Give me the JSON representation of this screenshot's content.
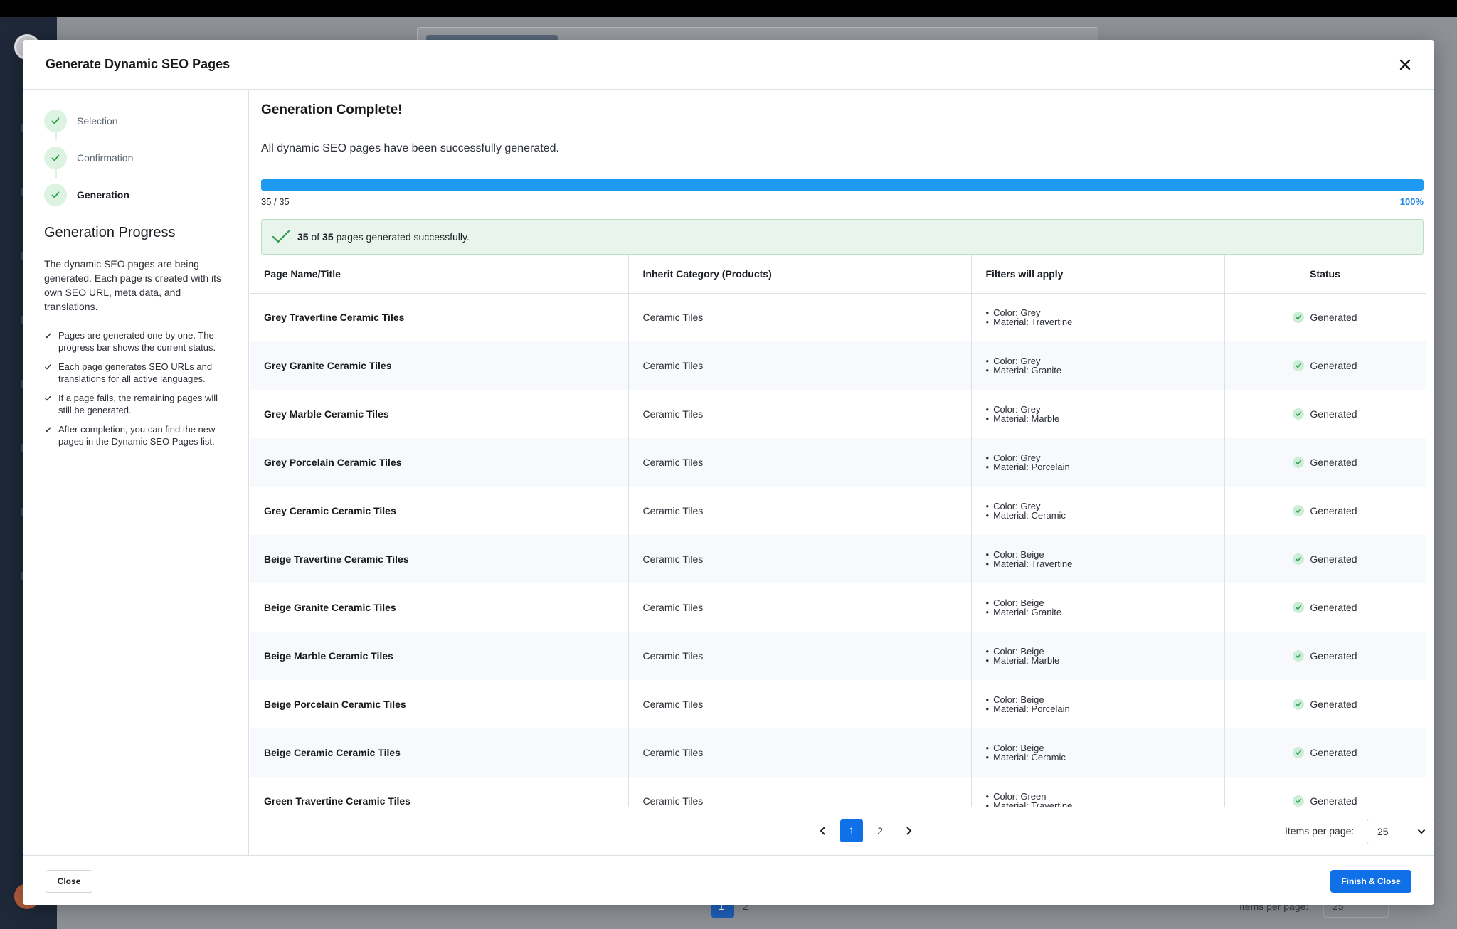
{
  "modal": {
    "title": "Generate Dynamic SEO Pages"
  },
  "steps": [
    {
      "label": "Selection",
      "done": true
    },
    {
      "label": "Confirmation",
      "done": true
    },
    {
      "label": "Generation",
      "done": true,
      "active": true
    }
  ],
  "left": {
    "title": "Generation Progress",
    "description": "The dynamic SEO pages are being generated. Each page is created with its own SEO URL, meta data, and translations.",
    "tips": [
      "Pages are generated one by one. The progress bar shows the current status.",
      "Each page generates SEO URLs and translations for all active languages.",
      "If a page fails, the remaining pages will still be generated.",
      "After completion, you can find the new pages in the Dynamic SEO Pages list."
    ]
  },
  "result": {
    "title": "Generation Complete!",
    "subtitle": "All dynamic SEO pages have been successfully generated.",
    "progress_fraction": 1.0,
    "progress_count": "35 / 35",
    "progress_percent": "100%",
    "banner_done": "35",
    "banner_of": "of",
    "banner_total": "35",
    "banner_suffix": "pages generated successfully."
  },
  "table": {
    "headers": [
      "Page Name/Title",
      "Inherit Category (Products)",
      "Filters will apply",
      "Status"
    ],
    "rows": [
      {
        "title": "Grey Travertine Ceramic Tiles",
        "category": "Ceramic Tiles",
        "filters": [
          "Color: Grey",
          "Material: Travertine"
        ],
        "status": "Generated"
      },
      {
        "title": "Grey Granite Ceramic Tiles",
        "category": "Ceramic Tiles",
        "filters": [
          "Color: Grey",
          "Material: Granite"
        ],
        "status": "Generated"
      },
      {
        "title": "Grey Marble Ceramic Tiles",
        "category": "Ceramic Tiles",
        "filters": [
          "Color: Grey",
          "Material: Marble"
        ],
        "status": "Generated"
      },
      {
        "title": "Grey Porcelain Ceramic Tiles",
        "category": "Ceramic Tiles",
        "filters": [
          "Color: Grey",
          "Material: Porcelain"
        ],
        "status": "Generated"
      },
      {
        "title": "Grey Ceramic Ceramic Tiles",
        "category": "Ceramic Tiles",
        "filters": [
          "Color: Grey",
          "Material: Ceramic"
        ],
        "status": "Generated"
      },
      {
        "title": "Beige Travertine Ceramic Tiles",
        "category": "Ceramic Tiles",
        "filters": [
          "Color: Beige",
          "Material: Travertine"
        ],
        "status": "Generated"
      },
      {
        "title": "Beige Granite Ceramic Tiles",
        "category": "Ceramic Tiles",
        "filters": [
          "Color: Beige",
          "Material: Granite"
        ],
        "status": "Generated"
      },
      {
        "title": "Beige Marble Ceramic Tiles",
        "category": "Ceramic Tiles",
        "filters": [
          "Color: Beige",
          "Material: Marble"
        ],
        "status": "Generated"
      },
      {
        "title": "Beige Porcelain Ceramic Tiles",
        "category": "Ceramic Tiles",
        "filters": [
          "Color: Beige",
          "Material: Porcelain"
        ],
        "status": "Generated"
      },
      {
        "title": "Beige Ceramic Ceramic Tiles",
        "category": "Ceramic Tiles",
        "filters": [
          "Color: Beige",
          "Material: Ceramic"
        ],
        "status": "Generated"
      },
      {
        "title": "Green Travertine Ceramic Tiles",
        "category": "Ceramic Tiles",
        "filters": [
          "Color: Green",
          "Material: Travertine"
        ],
        "status": "Generated"
      }
    ]
  },
  "pagination": {
    "pages": [
      "1",
      "2"
    ],
    "current": "1",
    "items_per_page_label": "Items per page:",
    "items_per_page": "25"
  },
  "footer": {
    "close_label": "Close",
    "finish_label": "Finish & Close"
  },
  "background": {
    "pages": [
      "1",
      "2"
    ],
    "items_per_page_label": "Items per page:",
    "items_per_page": "25"
  },
  "colors": {
    "accent": "#1070e8",
    "progress": "#1e9bf0",
    "success_bg": "#e9f5ec",
    "success_check": "#2e9e4f"
  }
}
